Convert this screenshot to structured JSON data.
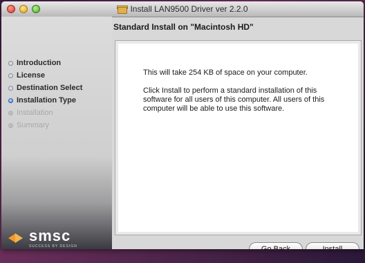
{
  "window": {
    "title": "Install LAN9500 Driver ver 2.2.0",
    "heading": "Standard Install on \"Macintosh HD\""
  },
  "steps": [
    {
      "label": "Introduction",
      "state": "done"
    },
    {
      "label": "License",
      "state": "done"
    },
    {
      "label": "Destination Select",
      "state": "done"
    },
    {
      "label": "Installation Type",
      "state": "current"
    },
    {
      "label": "Installation",
      "state": "future"
    },
    {
      "label": "Summary",
      "state": "future"
    }
  ],
  "content": {
    "line1": "This will take 254 KB of space on your computer.",
    "line2": "Click Install to perform a standard installation of this software for all users of this computer. All users of this computer will be able to use this software."
  },
  "logo": {
    "name": "smsc",
    "tagline": "SUCCESS BY DESIGN"
  },
  "buttons": {
    "back": "Go Back",
    "install": "Install"
  },
  "colors": {
    "current_step": "#3a7fd8",
    "logo_orange": "#f39a2a"
  }
}
